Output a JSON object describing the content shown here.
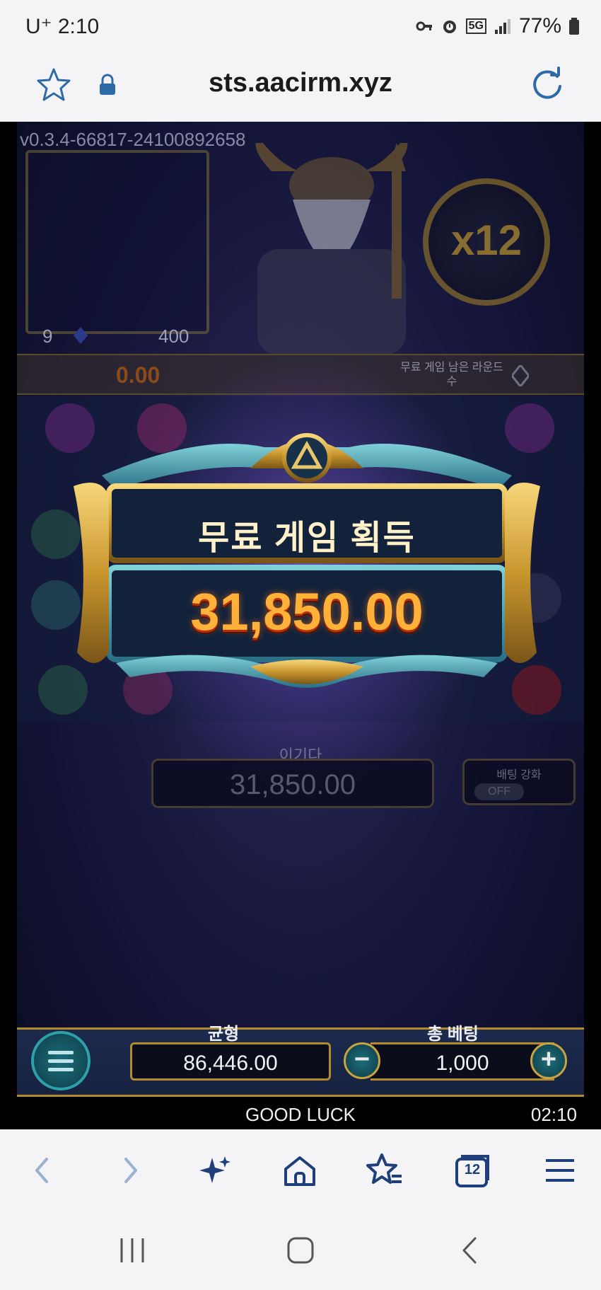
{
  "status_bar": {
    "carrier": "U⁺ 2:10",
    "network": "5G",
    "battery": "77%"
  },
  "browser": {
    "url": "sts.aacirm.xyz",
    "tab_count": "12"
  },
  "game": {
    "version": "v0.3.4-66817-24100892658",
    "portrait_left_number": "9",
    "portrait_right_number": "400",
    "multiplier": "x12",
    "strip_value": "0.00",
    "strip_label": "무료 게임 남은 라운드 수",
    "popup_title": "무료 게임 획득",
    "popup_amount": "31,850.00",
    "win_label": "이기다",
    "win_value": "31,850.00",
    "boost_label": "배팅 강화",
    "boost_state": "OFF",
    "balance_label": "균형",
    "balance_value": "86,446.00",
    "bet_label": "총 베팅",
    "bet_value": "1,000",
    "minus_symbol": "−",
    "plus_symbol": "+",
    "footer_message": "GOOD LUCK",
    "clock": "02:10"
  },
  "colors": {
    "accent_gold": "#b38b2e",
    "popup_amount": "#ffb13a",
    "browser_icon": "#2f6aa8"
  }
}
